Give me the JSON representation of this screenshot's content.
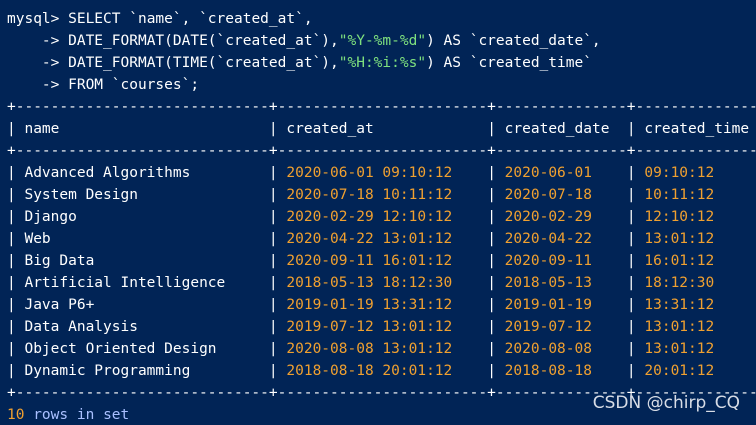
{
  "query": {
    "line1": {
      "prompt": "mysql>",
      "text": " SELECT `name`, `created_at`,"
    },
    "line2": {
      "cont": "    ->",
      "pre": " DATE_FORMAT(DATE(`created_at`),",
      "fmt": "\"%Y-%m-%d\"",
      "post": ") AS `created_date`,"
    },
    "line3": {
      "cont": "    ->",
      "pre": " DATE_FORMAT(TIME(`created_at`),",
      "fmt": "\"%H:%i:%s\"",
      "post": ") AS `created_time`"
    },
    "line4": {
      "cont": "    ->",
      "text": " FROM `courses`;"
    }
  },
  "table": {
    "border": "+-----------------------------+------------------------+---------------+---------------+",
    "headers": [
      "name",
      "created_at",
      "created_date",
      "created_time"
    ],
    "rows": [
      [
        "Advanced Algorithms",
        "2020-06-01 09:10:12",
        "2020-06-01",
        "09:10:12"
      ],
      [
        "System Design",
        "2020-07-18 10:11:12",
        "2020-07-18",
        "10:11:12"
      ],
      [
        "Django",
        "2020-02-29 12:10:12",
        "2020-02-29",
        "12:10:12"
      ],
      [
        "Web",
        "2020-04-22 13:01:12",
        "2020-04-22",
        "13:01:12"
      ],
      [
        "Big Data",
        "2020-09-11 16:01:12",
        "2020-09-11",
        "16:01:12"
      ],
      [
        "Artificial Intelligence",
        "2018-05-13 18:12:30",
        "2018-05-13",
        "18:12:30"
      ],
      [
        "Java P6+",
        "2019-01-19 13:31:12",
        "2019-01-19",
        "13:31:12"
      ],
      [
        "Data Analysis",
        "2019-07-12 13:01:12",
        "2019-07-12",
        "13:01:12"
      ],
      [
        "Object Oriented Design",
        "2020-08-08 13:01:12",
        "2020-08-08",
        "13:01:12"
      ],
      [
        "Dynamic Programming",
        "2018-08-18 20:01:12",
        "2018-08-18",
        "20:01:12"
      ]
    ]
  },
  "summary": {
    "count": "10",
    "kw1": "rows",
    "kw2": "in",
    "kw3": "set"
  },
  "watermark": "CSDN @chirp_CQ",
  "colors": {
    "background": "#012456",
    "text": "#ffffff",
    "string_literal": "#7ee07e",
    "value": "#f0a030"
  }
}
